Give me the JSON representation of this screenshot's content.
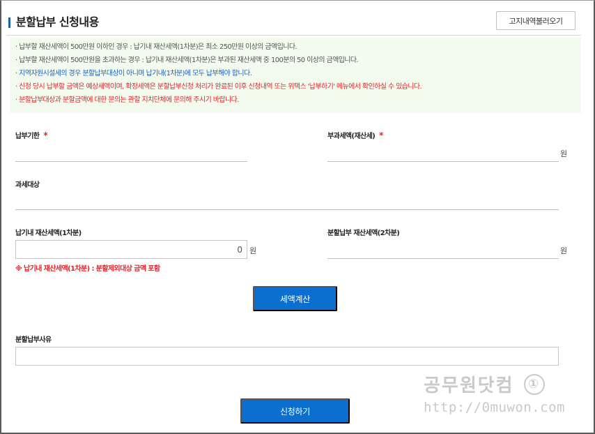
{
  "header": {
    "title": "분할납부 신청내용",
    "load_button": "고지내역불러오기"
  },
  "notices": [
    {
      "text": "· 납부할 재산세액이 500만원 이하인 경우 : 납기내 재산세액(1차분)은 최소 250만원 이상의 금액입니다.",
      "color": "gray"
    },
    {
      "text": "· 납부할 재산세액이 500만원을 초과하는 경우 : 납기내 재산세액(1차분)은 부과된 재산세액 중 100분의 50 이상의 금액입니다.",
      "color": "gray"
    },
    {
      "text": "· 지역자원시설세의 경우 분할납부대상이 아니며 납기내(1차분)에 모두 납부해야 합니다.",
      "color": "blue"
    },
    {
      "text": "· 신청 당시 납부할 금액은 예상세액이며, 확정세액은 분할납부신청 처리가 완료된 이후 신청내역 또는 위택스 '납부하기' 메뉴에서 확인하실 수 있습니다.",
      "color": "red"
    },
    {
      "text": "· 분할납부대상과 분할금액에 대한 문의는 관할 지치단체에 문의해 주시기 바랍니다.",
      "color": "red"
    }
  ],
  "form": {
    "due_date_label": "납부기한",
    "required_mark": "*",
    "assessed_tax_label": "부과세액(재산세)",
    "unit_won": "원",
    "tax_target_label": "과세대상",
    "first_installment_label": "납기내 재산세액(1차분)",
    "first_installment_value": "0",
    "second_installment_label": "분할납부 재산세액(2차분)",
    "warning": "※ 납기내 재산세액(1차분) : 분할제외대상 금액 포함",
    "calc_button": "세액계산",
    "reason_label": "분할납부사유",
    "submit_button": "신청하기"
  },
  "watermark": {
    "name": "공무원닷컴",
    "badge": "①",
    "url": "http://0muwon.com"
  },
  "colors": {
    "accent": "#0a6fce",
    "notice_bg": "#f3fbef",
    "warning": "#e8232a",
    "info_blue": "#1f5fbf"
  }
}
